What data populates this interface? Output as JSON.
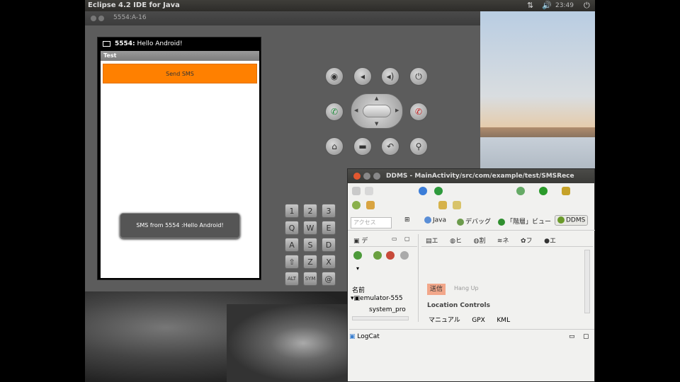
{
  "topbar": {
    "title": "Eclipse 4.2 IDE for Java",
    "clock": "23:49"
  },
  "emulator": {
    "window_title": "5554:A-16",
    "status_text": "5554:",
    "status_bold": "Hello Android!",
    "app_title": "Test",
    "send_button": "Send SMS",
    "toast": "SMS from 5554 :Hello Android!"
  },
  "keyboard": {
    "rows": [
      [
        "1",
        "2",
        "3"
      ],
      [
        "Q",
        "W",
        "E"
      ],
      [
        "A",
        "S",
        "D"
      ],
      [
        "⇧",
        "Z",
        "X"
      ],
      [
        "ALT",
        "SYM",
        "@"
      ]
    ]
  },
  "ddms": {
    "window_title": "DDMS - MainActivity/src/com/example/test/SMSRece",
    "quick_access": "アクセス",
    "perspectives": [
      "Java",
      "デバッグ",
      "「階層」ビュー",
      "DDMS"
    ],
    "devices_tab": "デ",
    "name_column": "名前",
    "device": "emulator-555",
    "process": "system_pro",
    "emu_tabs": [
      "エ",
      "ヒ",
      "割",
      "ネ",
      "フ",
      "エ"
    ],
    "sms_tab": "送信",
    "hangup": "Hang Up",
    "location_controls": "Location Controls",
    "location_tabs": [
      "マニュアル",
      "GPX",
      "KML"
    ],
    "logcat": "LogCat"
  },
  "colors": {
    "send_button": "#ff8000",
    "title_bar": "#3c3c3c",
    "close_button": "#e2572f"
  }
}
